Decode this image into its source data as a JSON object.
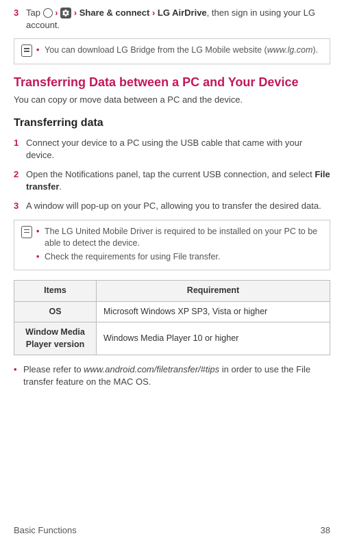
{
  "step_top": {
    "num": "3",
    "pre": "Tap ",
    "sep": " › ",
    "bold1": "Share & connect",
    "bold2": "LG AirDrive",
    "post": ", then sign in using your LG account."
  },
  "note1": {
    "items": [
      {
        "pre": "You can download LG Bridge from the LG Mobile website (",
        "url": "www.lg.com",
        "post": ")."
      }
    ]
  },
  "section_title": "Transferring Data between a PC and Your Device",
  "intro": "You can copy or move data between a PC and the device.",
  "subsection_title": "Transferring data",
  "steps": [
    {
      "num": "1",
      "text": "Connect your device to a PC using the USB cable that came with your device."
    },
    {
      "num": "2",
      "pre": "Open the Notifications panel, tap the current USB connection, and select ",
      "bold": "File transfer",
      "post": "."
    },
    {
      "num": "3",
      "text": "A window will pop-up on your PC, allowing you to transfer the desired data."
    }
  ],
  "note2": {
    "items": [
      {
        "text": "The LG United Mobile Driver is required to be installed on your PC to be able to detect the device."
      },
      {
        "text": "Check the requirements for using File transfer."
      }
    ]
  },
  "table": {
    "head": {
      "c1": "Items",
      "c2": "Requirement"
    },
    "rows": [
      {
        "label": "OS",
        "value": "Microsoft Windows XP SP3, Vista or higher"
      },
      {
        "label": "Window Media Player version",
        "value": "Windows Media Player 10 or higher"
      }
    ]
  },
  "bullet_mac": {
    "pre": "Please refer to ",
    "url": "www.android.com/filetransfer/#tips",
    "post": " in order to use the File transfer feature on the MAC OS."
  },
  "footer": {
    "section": "Basic Functions",
    "page": "38"
  }
}
